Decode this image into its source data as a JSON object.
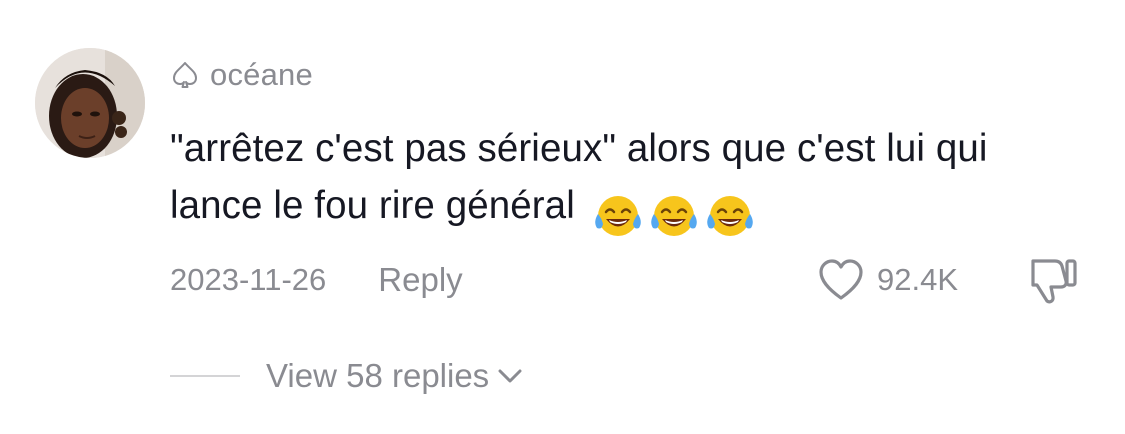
{
  "comment": {
    "author": "océane",
    "text": "\"arrêtez c'est pas sérieux\" alors que c'est lui qui lance le fou rire général",
    "emojis": [
      "face-with-tears-of-joy",
      "face-with-tears-of-joy",
      "face-with-tears-of-joy"
    ],
    "date": "2023-11-26",
    "reply_label": "Reply",
    "like_count": "92.4K",
    "view_replies_label": "View 58 replies",
    "icons": {
      "badge": "spade-icon",
      "like": "heart-outline-icon",
      "dislike": "thumbs-down-icon",
      "expand": "chevron-down-icon"
    }
  },
  "colors": {
    "text_primary": "#161823",
    "text_secondary": "#8a8b91",
    "divider": "#d4d4d6"
  }
}
